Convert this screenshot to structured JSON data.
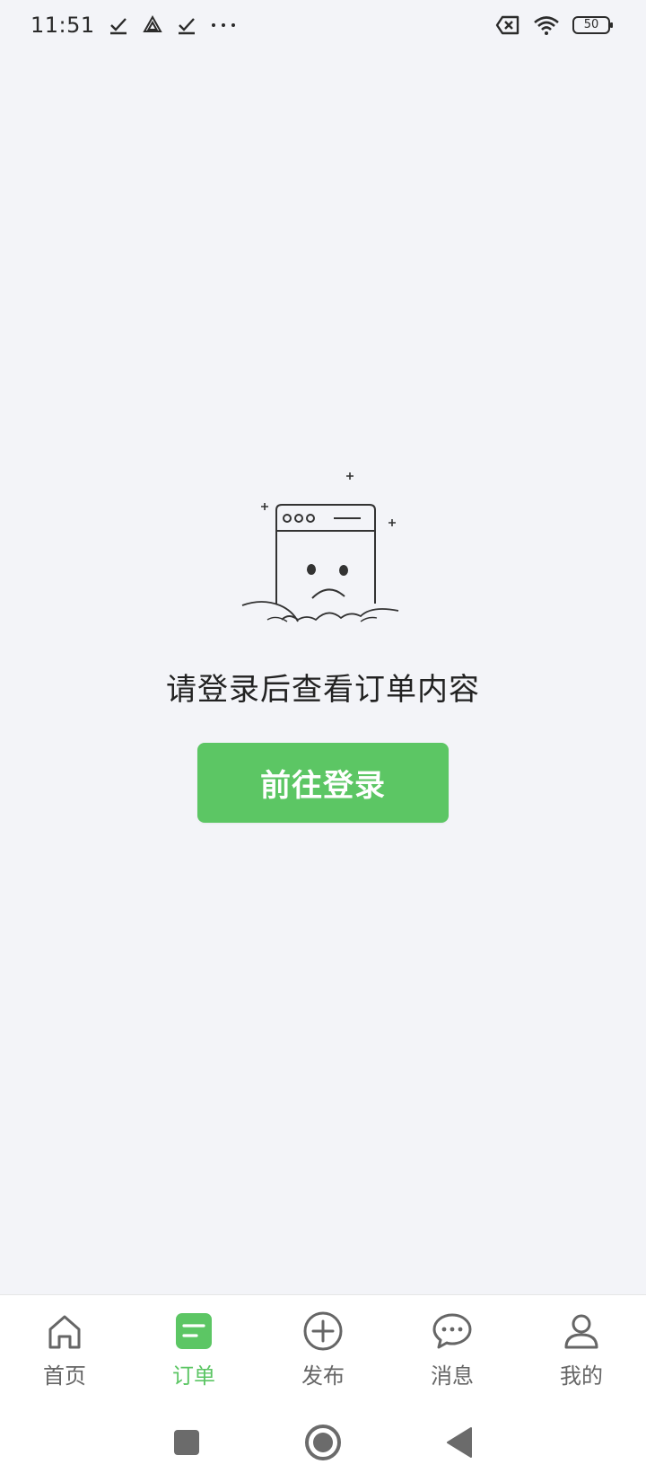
{
  "status_bar": {
    "time": "11:51",
    "battery": "50",
    "icons": [
      "check-icon",
      "drive-icon",
      "check-icon",
      "more-dots-icon",
      "sim-off-icon",
      "wifi-icon",
      "battery-icon"
    ]
  },
  "empty_state": {
    "illustration": "sad-browser-window-illustration",
    "message": "请登录后查看订单内容",
    "button_label": "前往登录"
  },
  "tabs": [
    {
      "label": "首页",
      "icon": "home-icon",
      "active": false
    },
    {
      "label": "订单",
      "icon": "order-icon",
      "active": true
    },
    {
      "label": "发布",
      "icon": "plus-circle-icon",
      "active": false
    },
    {
      "label": "消息",
      "icon": "message-icon",
      "active": false
    },
    {
      "label": "我的",
      "icon": "user-icon",
      "active": false
    }
  ],
  "system_nav": [
    "recent-apps-icon",
    "home-circle-icon",
    "back-triangle-icon"
  ],
  "colors": {
    "accent": "#5cc664",
    "background": "#f3f4f8",
    "tab_inactive": "#666666"
  }
}
